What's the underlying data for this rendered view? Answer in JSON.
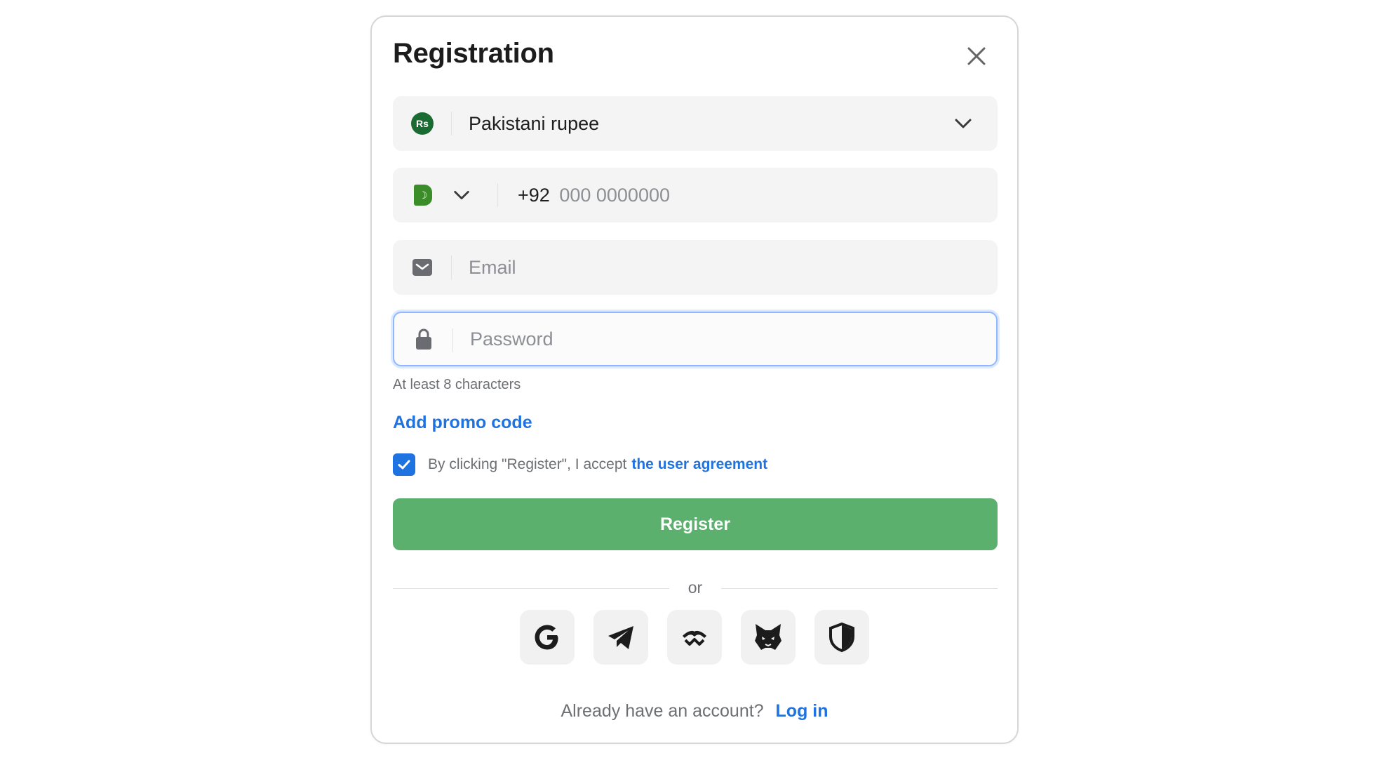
{
  "modal": {
    "title": "Registration",
    "close_icon": "close-icon"
  },
  "currency": {
    "badge": "Rs",
    "value": "Pakistani rupee",
    "chevron_icon": "chevron-down-icon"
  },
  "phone": {
    "flag_icon": "pakistan-flag-icon",
    "chevron_icon": "chevron-down-icon",
    "prefix": "+92",
    "placeholder": "000 0000000"
  },
  "email": {
    "icon": "envelope-icon",
    "placeholder": "Email"
  },
  "password": {
    "icon": "lock-icon",
    "placeholder": "Password",
    "hint": "At least 8 characters"
  },
  "promo": {
    "label": "Add promo code"
  },
  "agreement": {
    "checked": true,
    "text": "By clicking \"Register\", I accept",
    "link": "the user agreement"
  },
  "register_button": {
    "label": "Register"
  },
  "divider": {
    "label": "or"
  },
  "social": [
    {
      "icon": "google-icon"
    },
    {
      "icon": "telegram-icon"
    },
    {
      "icon": "walletconnect-icon"
    },
    {
      "icon": "metamask-fox-icon"
    },
    {
      "icon": "shield-icon"
    }
  ],
  "footer": {
    "question": "Already have an account?",
    "login": "Log in"
  },
  "colors": {
    "accent": "#1f73e0",
    "register_green": "#5bb06e",
    "field_bg": "#f4f4f5",
    "focus_border": "#8fb8ff",
    "rupee_badge": "#1a6b31"
  }
}
